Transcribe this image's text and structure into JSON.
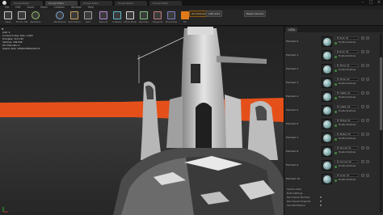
{
  "titlebar": {
    "tabs": [
      "Unreal Editor",
      "Unreal Editor",
      "Unreal Editor",
      "Unreal Editor",
      "Unreal Editor"
    ],
    "active_tab": 1,
    "window_buttons": [
      "–",
      "□",
      "×"
    ]
  },
  "menubar": [
    "File",
    "Edit",
    "Asset",
    "Mesh",
    "Collision",
    "Window",
    "Help"
  ],
  "toolbar": {
    "buttons": [
      {
        "label": "Save",
        "icon": "save-icon"
      },
      {
        "label": "Find in CB",
        "icon": "find-icon"
      },
      {
        "label": "Reimport",
        "icon": "reimport-icon"
      },
      {
        "label": "Wireframe",
        "icon": "wireframe-icon"
      },
      {
        "label": "Vert Colors",
        "icon": "vertex-colors-icon"
      },
      {
        "label": "Grid",
        "icon": "grid-icon"
      },
      {
        "label": "Bounds",
        "icon": "bounds-icon"
      },
      {
        "label": "Collision",
        "icon": "collision-icon"
      },
      {
        "label": "Show Pivot",
        "icon": "pivot-icon"
      },
      {
        "label": "Normals",
        "icon": "normals-icon"
      },
      {
        "label": "Tangents",
        "icon": "tangents-icon"
      },
      {
        "label": "Binormals",
        "icon": "binormals-icon"
      },
      {
        "label": "UV",
        "icon": "uv-icon"
      },
      {
        "label": "Sockets",
        "icon": "sockets-icon"
      },
      {
        "label": "Camera",
        "icon": "camera-icon"
      }
    ],
    "uv_channel": "UV Channel 0",
    "lod_select": "LOD Auto",
    "reset_camera": "Reset Camera"
  },
  "viewport": {
    "toggle": "▼",
    "stats": [
      "LOD: 0",
      "Current Screen Size: 1.000",
      "Triangles: 112,740",
      "Vertices: 158,049",
      "UV Channels: 2",
      "Approx Size: 10542x5954x10171"
    ]
  },
  "panel": {
    "tab": "LODs",
    "element_label": "Element",
    "rows": [
      {
        "element": "Element 0",
        "material": "M_Rock_01",
        "sub": "Enable Shadows"
      },
      {
        "element": "Element 1",
        "material": "M_Rock_02",
        "sub": "Enable Shadows"
      },
      {
        "element": "Element 2",
        "material": "M_Stone_01",
        "sub": "Enable Shadows"
      },
      {
        "element": "Element 3",
        "material": "M_Stone_02",
        "sub": "Enable Shadows"
      },
      {
        "element": "Element 4",
        "material": "M_Castle_01",
        "sub": "Enable Shadows"
      },
      {
        "element": "Element 5",
        "material": "M_Castle_02",
        "sub": "Enable Shadows"
      },
      {
        "element": "Element 6",
        "material": "M_Statue_01",
        "sub": "Enable Shadows"
      },
      {
        "element": "Element 7",
        "material": "M_Statue_02",
        "sub": "Enable Shadows"
      },
      {
        "element": "Element 8",
        "material": "M_Ground_01",
        "sub": "Enable Shadows"
      },
      {
        "element": "Element 9",
        "material": "M_Ground_02",
        "sub": "Enable Shadows"
      },
      {
        "element": "Element 10",
        "material": "M_Snow_01",
        "sub": "Enable Shadows"
      }
    ],
    "props": [
      {
        "label": "Section Data",
        "value": ""
      },
      {
        "label": "Build Settings",
        "value": ""
      },
      {
        "label": "Recompute Normals",
        "value": ""
      },
      {
        "label": "Recompute Tangents",
        "value": ""
      },
      {
        "label": "Use MikkTSpace",
        "value": ""
      }
    ]
  },
  "colors": {
    "accent": "#e07b1a",
    "horizon": "#e5501a",
    "thumb_teal": "#8fb5b6"
  }
}
